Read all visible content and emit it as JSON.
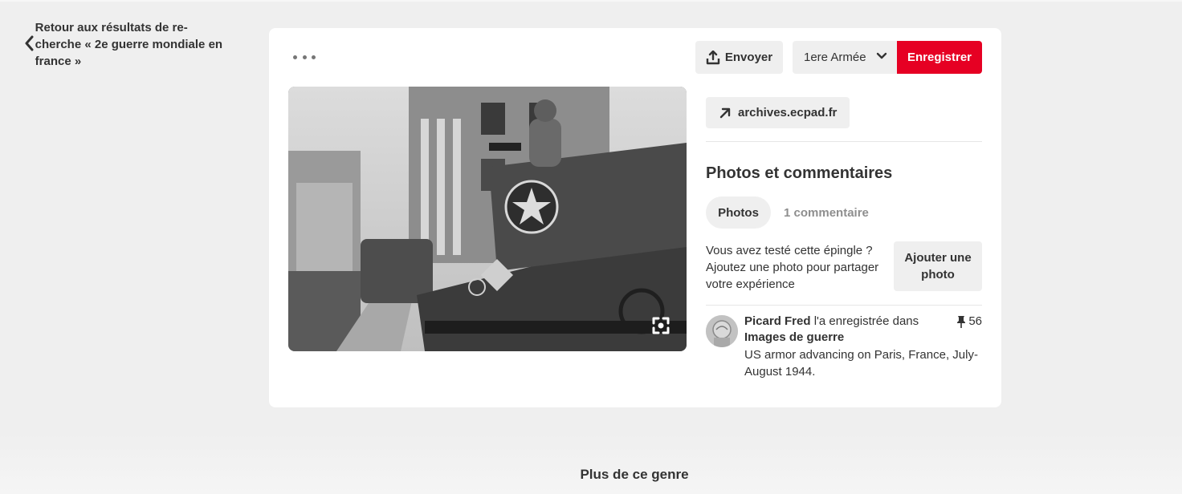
{
  "back": {
    "label": "Retour aux résultats de re-cherche « 2e guerre mondiale en france »"
  },
  "toolbar": {
    "more_icon": "more-horizontal-icon",
    "send_label": "Envoyer",
    "send_icon": "share-upload-icon",
    "board_selected": "1ere Armée",
    "board_icon": "chevron-down-icon",
    "save_label": "Enregistrer",
    "save_color": "#e60023"
  },
  "image": {
    "lens_icon": "visual-search-icon"
  },
  "source": {
    "label": "archives.ecpad.fr",
    "icon": "arrow-up-right-icon"
  },
  "photos_section": {
    "title": "Photos et commentaires",
    "tabs": [
      {
        "label": "Photos",
        "active": true
      },
      {
        "label": "1 commentaire",
        "active": false
      }
    ],
    "prompt": "Vous avez testé cette épingle ? Ajoutez une photo pour partager votre expérience",
    "add_photo_label": "Ajouter une photo"
  },
  "activity": {
    "user": "Picard Fred",
    "action": " l'a enregistrée dans",
    "board": "Images de guerre",
    "description": "US armor advancing on Paris, France, July-August 1944.",
    "pin_count": "56",
    "pin_icon": "pushpin-icon"
  },
  "footer": {
    "more_like_this": "Plus de ce genre"
  }
}
